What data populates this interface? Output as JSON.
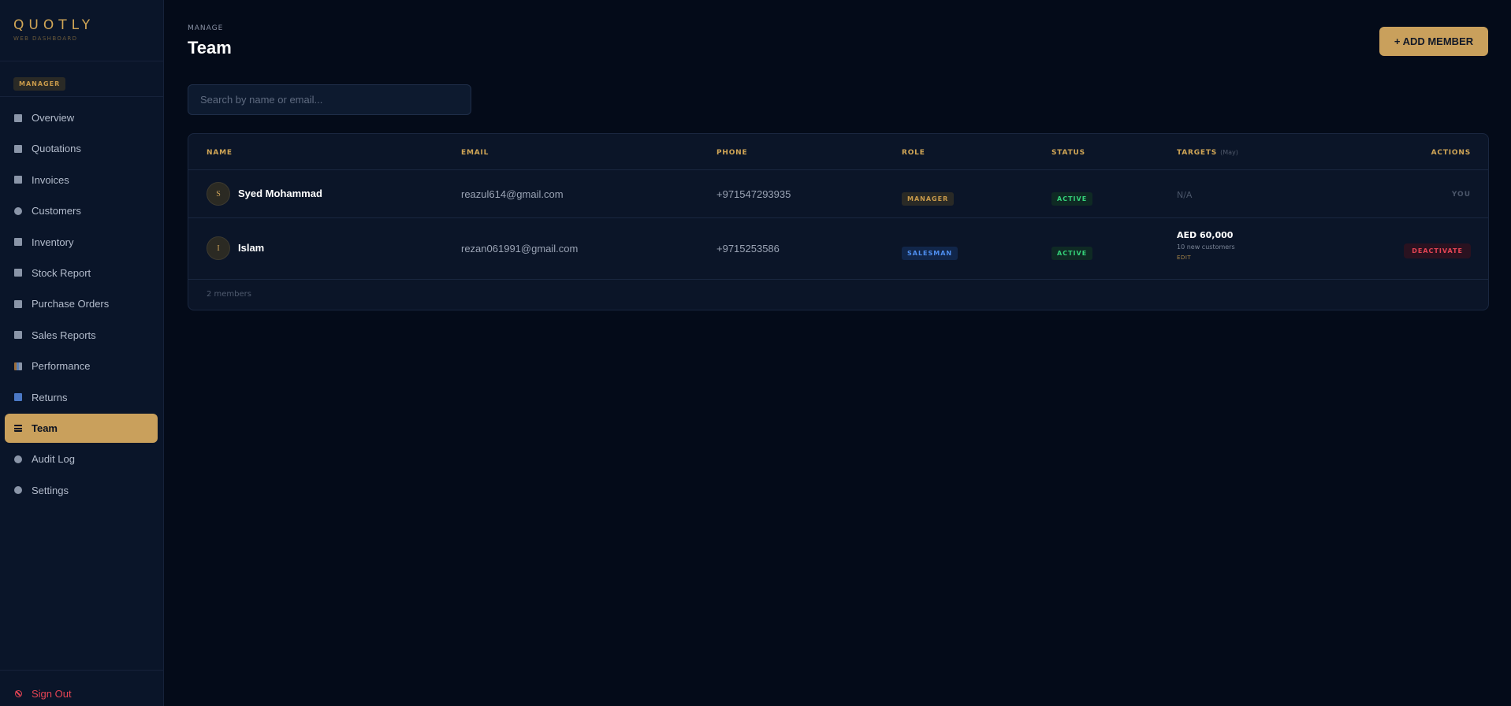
{
  "brand": {
    "name": "QUOTLY",
    "subtitle": "WEB DASHBOARD"
  },
  "user_role_badge": "MANAGER",
  "sidebar": {
    "items": [
      {
        "label": "Overview",
        "icon": "grid-icon"
      },
      {
        "label": "Quotations",
        "icon": "document-icon"
      },
      {
        "label": "Invoices",
        "icon": "receipt-icon"
      },
      {
        "label": "Customers",
        "icon": "customers-icon"
      },
      {
        "label": "Inventory",
        "icon": "inventory-icon"
      },
      {
        "label": "Stock Report",
        "icon": "stock-report-icon"
      },
      {
        "label": "Purchase Orders",
        "icon": "purchase-orders-icon"
      },
      {
        "label": "Sales Reports",
        "icon": "sales-reports-icon"
      },
      {
        "label": "Performance",
        "icon": "bar-chart-icon"
      },
      {
        "label": "Returns",
        "icon": "returns-icon"
      },
      {
        "label": "Team",
        "icon": "menu-lines-icon"
      },
      {
        "label": "Audit Log",
        "icon": "clock-icon"
      },
      {
        "label": "Settings",
        "icon": "gear-icon"
      }
    ],
    "active_index": 10,
    "sign_out": "Sign Out"
  },
  "header": {
    "eyebrow": "MANAGE",
    "title": "Team",
    "add_button": "+ ADD MEMBER"
  },
  "search": {
    "placeholder": "Search by name or email...",
    "value": ""
  },
  "table": {
    "columns": {
      "name": "NAME",
      "email": "EMAIL",
      "phone": "PHONE",
      "role": "ROLE",
      "status": "STATUS",
      "targets": "TARGETS",
      "targets_sub": "(May)",
      "actions": "ACTIONS"
    },
    "rows": [
      {
        "initial": "S",
        "name": "Syed Mohammad",
        "email": "reazul614@gmail.com",
        "phone": "+971547293935",
        "role": "MANAGER",
        "status": "ACTIVE",
        "target": "N/A",
        "action": "YOU"
      },
      {
        "initial": "I",
        "name": "Islam",
        "email": "rezan061991@gmail.com",
        "phone": "+9715253586",
        "role": "SALESMAN",
        "status": "ACTIVE",
        "target_amount": "AED 60,000",
        "target_note": "10 new customers",
        "target_edit": "EDIT",
        "action": "DEACTIVATE"
      }
    ],
    "footer": "2 members"
  },
  "colors": {
    "accent": "#c9a05c",
    "background": "#040b19",
    "sidebar": "#0a1529",
    "active_status": "#34d27a",
    "danger": "#e54454",
    "salesman_role": "#4f8ff0"
  }
}
